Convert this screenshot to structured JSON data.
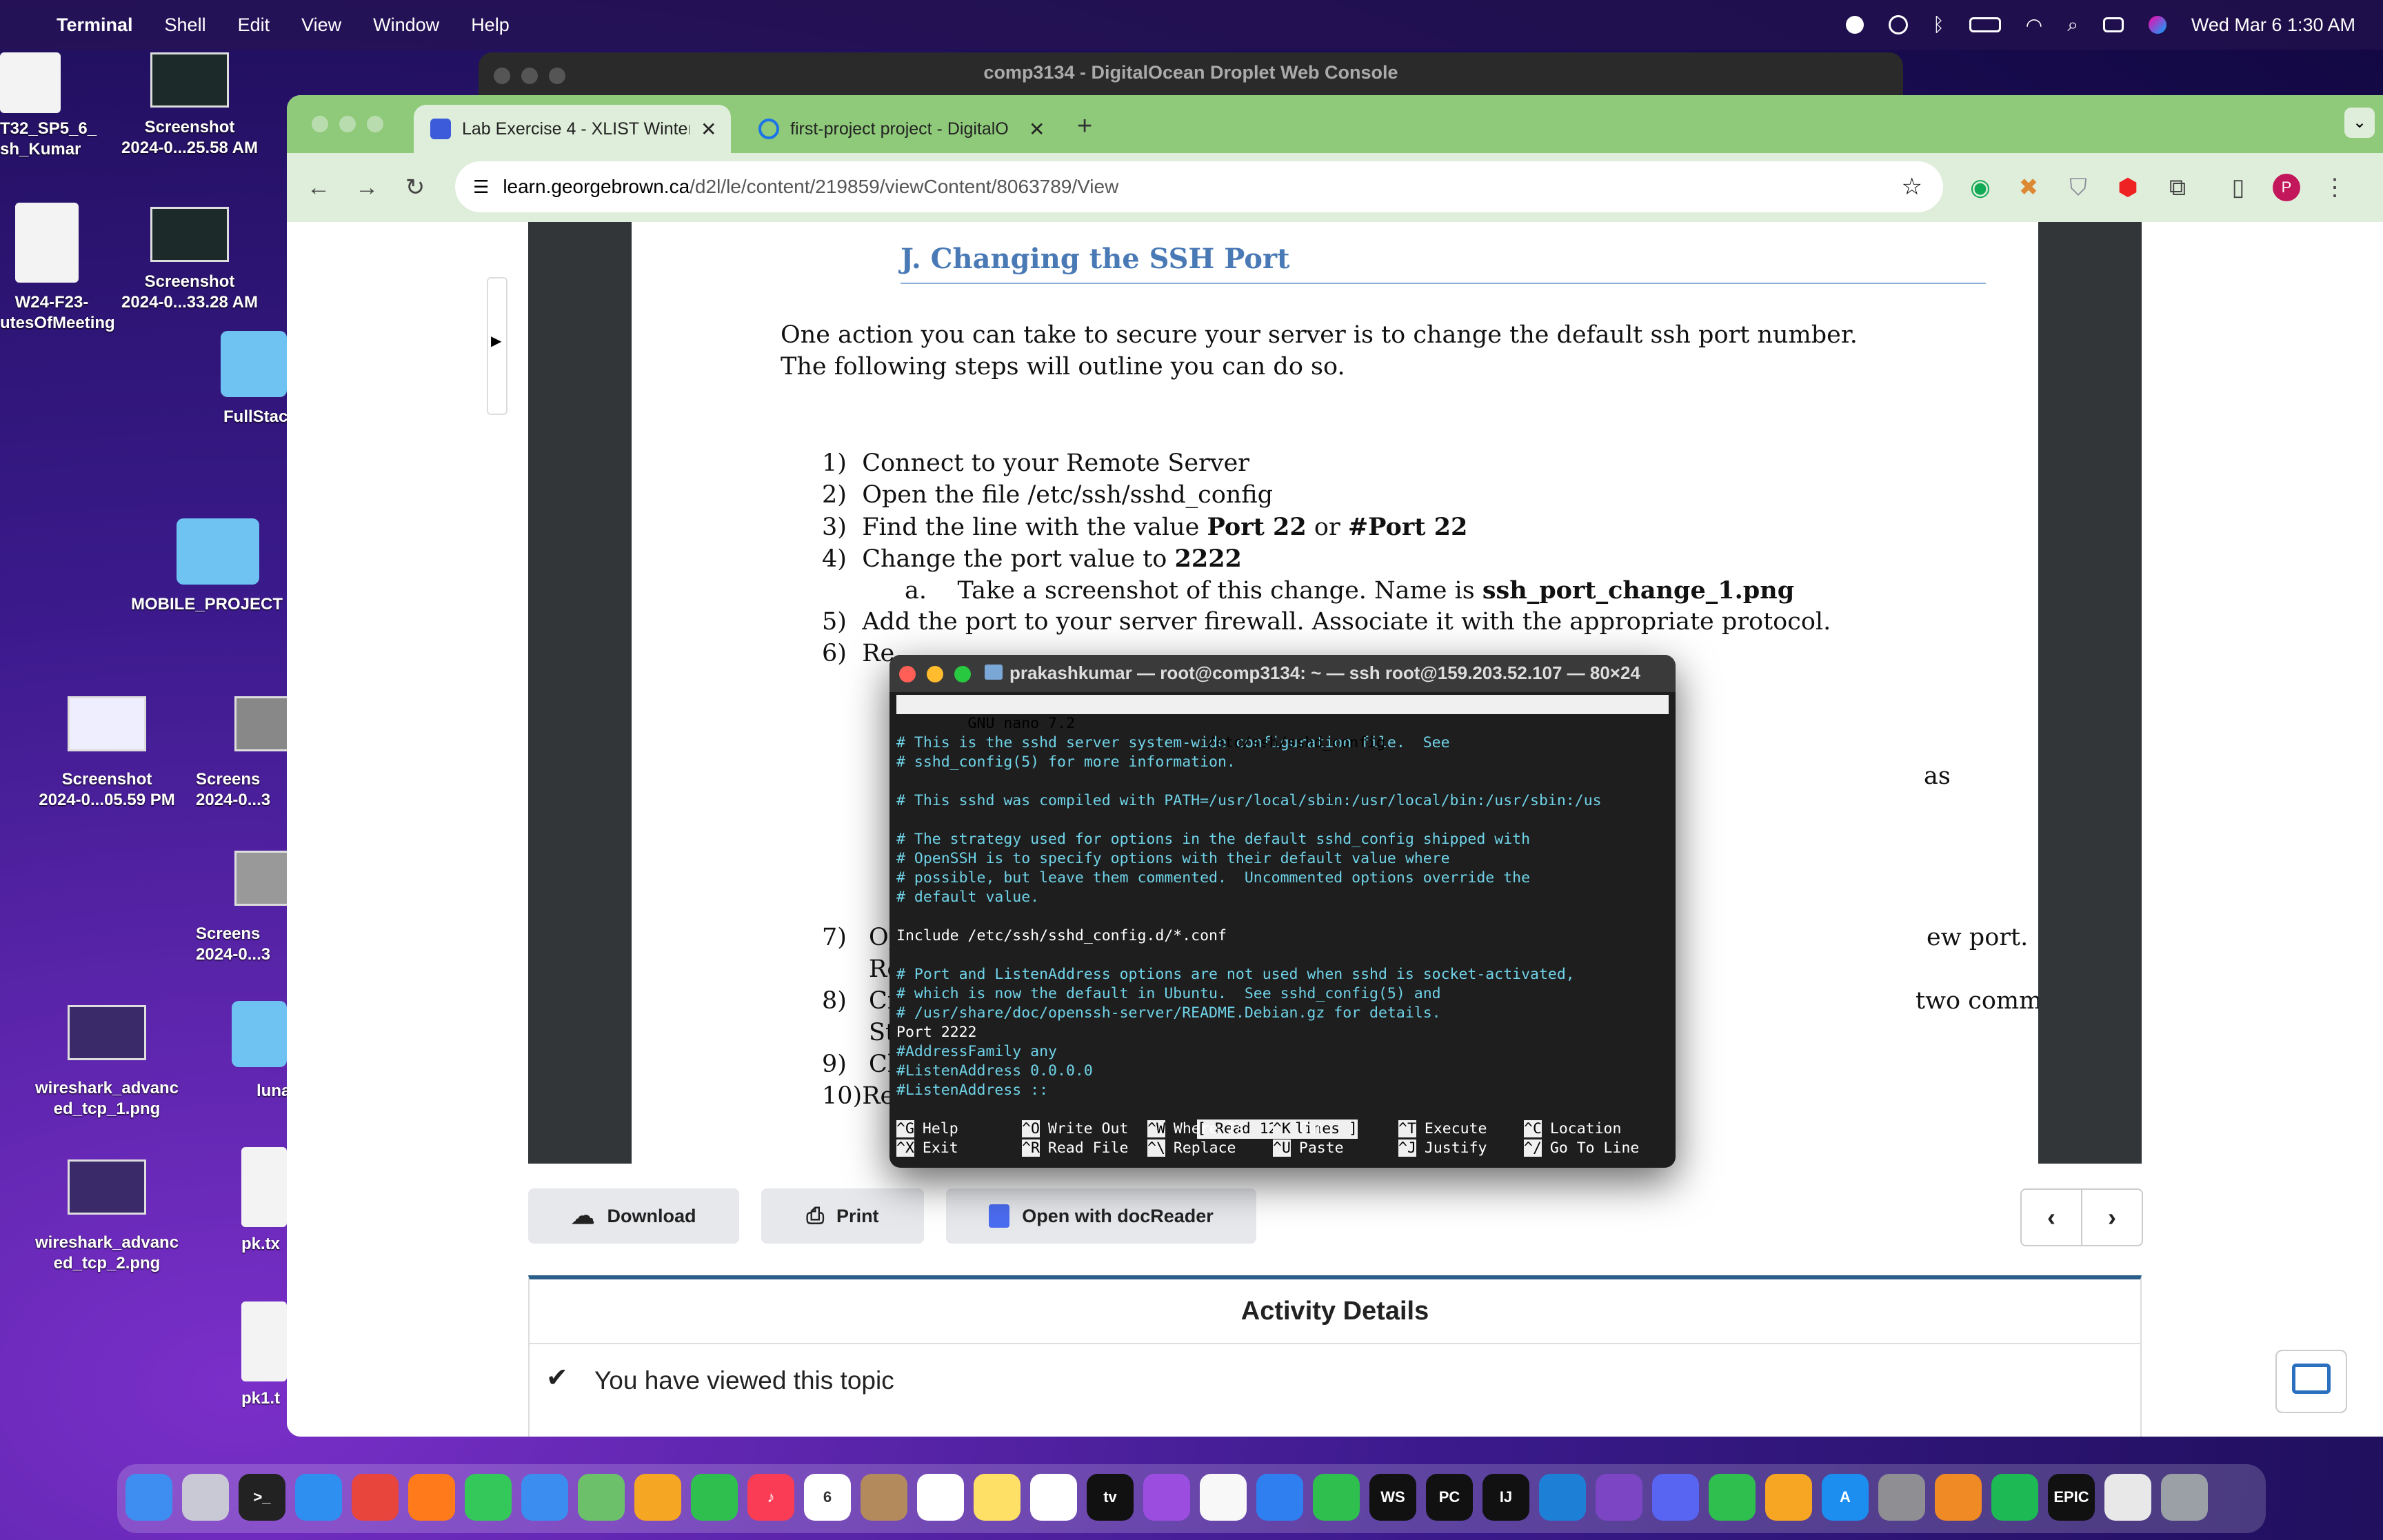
{
  "menubar": {
    "app_name": "Terminal",
    "menus": [
      "Shell",
      "Edit",
      "View",
      "Window",
      "Help"
    ],
    "datetime": "Wed Mar 6  1:30 AM"
  },
  "desktop": {
    "items": [
      {
        "label": "T32_SP5_6_\nsh_Kumar",
        "kind": "file",
        "badge": "DOCX"
      },
      {
        "label": "Screenshot\n2024-0...25.58 AM",
        "kind": "screenshot"
      },
      {
        "label": "W24-F23-\nutesOfMeeting",
        "kind": "file",
        "badge": "DOCX"
      },
      {
        "label": "Screenshot\n2024-0...33.28 AM",
        "kind": "screenshot"
      },
      {
        "label": "FullStac",
        "kind": "folder"
      },
      {
        "label": "MOBILE_PROJECT",
        "kind": "folder"
      },
      {
        "label": "Screenshot\n2024-0...05.59 PM",
        "kind": "screenshot"
      },
      {
        "label": "Screens\n2024-0...3",
        "kind": "screenshot"
      },
      {
        "label": "Screens\n2024-0...3",
        "kind": "screenshot"
      },
      {
        "label": "wireshark_advanc\ned_tcp_1.png",
        "kind": "screenshot"
      },
      {
        "label": "luna",
        "kind": "folder"
      },
      {
        "label": "wireshark_advanc\ned_tcp_2.png",
        "kind": "screenshot"
      },
      {
        "label": "pk.tx",
        "kind": "file",
        "badge": "TXT"
      },
      {
        "label": "pk1.t",
        "kind": "file",
        "badge": "TXT"
      }
    ]
  },
  "console_window": {
    "title": "comp3134 - DigitalOcean Droplet Web Console"
  },
  "browser": {
    "tabs": [
      {
        "label": "Lab Exercise 4 - XLIST Winter",
        "active": true
      },
      {
        "label": "first-project project - DigitalO",
        "active": false
      }
    ],
    "url_domain": "learn.georgebrown.ca",
    "url_path": "/d2l/le/content/219859/viewContent/8063789/View",
    "profile_initial": "P"
  },
  "document": {
    "heading": "J.  Changing the SSH Port",
    "intro_1": "One action you can take to secure your server is to change the default ssh port number.",
    "intro_2": "The following steps will outline you can do so.",
    "steps": [
      {
        "num": "1)",
        "pre": "Connect to your Remote Server",
        "bold": "",
        "post": ""
      },
      {
        "num": "2)",
        "pre": "Open the file /etc/ssh/sshd_config",
        "bold": "",
        "post": ""
      },
      {
        "num": "3)",
        "pre": "Find the line with the value ",
        "bold": "Port 22",
        "mid": " or ",
        "bold2": "#Port 22"
      },
      {
        "num": "4)",
        "pre": "Change the port value to ",
        "bold": "2222",
        "post": ""
      },
      {
        "num": "a.",
        "pre": "Take a screenshot of this change. Name is ",
        "bold": "ssh_port_change_1.png",
        "post": ""
      },
      {
        "num": "5)",
        "pre": "Add the port to your server firewall. Associate it with the appropriate protocol.",
        "bold": "",
        "post": ""
      },
      {
        "num": "6)",
        "pre": "Re",
        "bold": "",
        "post": ""
      }
    ],
    "partial_right": {
      "as": "as",
      "new_port": "ew port.",
      "two_cmds": "two commands for"
    },
    "partial_left": {
      "s7": "7)",
      "s7t": "Op",
      "s7b": "Re",
      "s8": "8)",
      "s8t": "Cr",
      "s8b": "St",
      "s9": "9)",
      "s9t": "Ch",
      "s10": "10)Re"
    }
  },
  "doc_buttons": {
    "download": "Download",
    "print": "Print",
    "open_with": "Open with docReader"
  },
  "activity": {
    "title": "Activity Details",
    "viewed": "You have viewed this topic"
  },
  "terminal": {
    "title": "prakashkumar — root@comp3134: ~ — ssh root@159.203.52.107 — 80×24",
    "nano_version": "  GNU nano 7.2",
    "nano_file": "/etc/ssh/sshd_config",
    "lines": [
      {
        "t": "",
        "c": false
      },
      {
        "t": "# This is the sshd server system-wide configuration file.  See",
        "c": true
      },
      {
        "t": "# sshd_config(5) for more information.",
        "c": true
      },
      {
        "t": "",
        "c": false
      },
      {
        "t": "# This sshd was compiled with PATH=/usr/local/sbin:/usr/local/bin:/usr/sbin:/us",
        "c": true
      },
      {
        "t": "",
        "c": false
      },
      {
        "t": "# The strategy used for options in the default sshd_config shipped with",
        "c": true
      },
      {
        "t": "# OpenSSH is to specify options with their default value where",
        "c": true
      },
      {
        "t": "# possible, but leave them commented.  Uncommented options override the",
        "c": true
      },
      {
        "t": "# default value.",
        "c": true
      },
      {
        "t": "",
        "c": false
      },
      {
        "t": "Include /etc/ssh/sshd_config.d/*.conf",
        "c": false
      },
      {
        "t": "",
        "c": false
      },
      {
        "t": "# Port and ListenAddress options are not used when sshd is socket-activated,",
        "c": true
      },
      {
        "t": "# which is now the default in Ubuntu.  See sshd_config(5) and",
        "c": true
      },
      {
        "t": "# /usr/share/doc/openssh-server/README.Debian.gz for details.",
        "c": true
      },
      {
        "t": "Port 2222",
        "c": false
      },
      {
        "t": "#AddressFamily any",
        "c": true
      },
      {
        "t": "#ListenAddress 0.0.0.0",
        "c": true
      },
      {
        "t": "#ListenAddress ::",
        "c": true
      }
    ],
    "status": "[ Read 125 lines ]",
    "shortcuts": [
      {
        "k1": "^G",
        "l1": "Help",
        "k2": "^X",
        "l2": "Exit"
      },
      {
        "k1": "^O",
        "l1": "Write Out",
        "k2": "^R",
        "l2": "Read File"
      },
      {
        "k1": "^W",
        "l1": "Where Is",
        "k2": "^\\",
        "l2": "Replace"
      },
      {
        "k1": "^K",
        "l1": "Cut",
        "k2": "^U",
        "l2": "Paste"
      },
      {
        "k1": "^T",
        "l1": "Execute",
        "k2": "^J",
        "l2": "Justify"
      },
      {
        "k1": "^C",
        "l1": "Location",
        "k2": "^/",
        "l2": "Go To Line"
      }
    ]
  },
  "dock": {
    "apps": [
      {
        "name": "finder-icon",
        "color": "#3d8ef0",
        "glyph": ""
      },
      {
        "name": "launchpad-icon",
        "color": "#c9c9d6",
        "glyph": ""
      },
      {
        "name": "terminal-app-icon",
        "color": "#222222",
        "glyph": ">_"
      },
      {
        "name": "safari-icon",
        "color": "#2f8ff0",
        "glyph": ""
      },
      {
        "name": "chrome-icon",
        "color": "#e8453c",
        "glyph": ""
      },
      {
        "name": "firefox-icon",
        "color": "#ff7a1a",
        "glyph": ""
      },
      {
        "name": "messages-icon",
        "color": "#34c759",
        "glyph": ""
      },
      {
        "name": "mail-icon",
        "color": "#3b8ef0",
        "glyph": ""
      },
      {
        "name": "maps-icon",
        "color": "#6cc06a",
        "glyph": ""
      },
      {
        "name": "photos-icon",
        "color": "#f5a623",
        "glyph": ""
      },
      {
        "name": "facetime-icon",
        "color": "#2fbf4f",
        "glyph": ""
      },
      {
        "name": "music-icon",
        "color": "#fa3c55",
        "glyph": "♪"
      },
      {
        "name": "calendar-icon",
        "color": "#ffffff",
        "glyph": "6"
      },
      {
        "name": "contacts-icon",
        "color": "#b28a5c",
        "glyph": ""
      },
      {
        "name": "reminders-icon",
        "color": "#ffffff",
        "glyph": ""
      },
      {
        "name": "notes-icon",
        "color": "#ffe066",
        "glyph": ""
      },
      {
        "name": "freeform-icon",
        "color": "#ffffff",
        "glyph": ""
      },
      {
        "name": "appletv-icon",
        "color": "#111111",
        "glyph": "tv"
      },
      {
        "name": "podcasts-icon",
        "color": "#9b4de0",
        "glyph": ""
      },
      {
        "name": "news-icon",
        "color": "#f8f8f8",
        "glyph": ""
      },
      {
        "name": "keynote-icon",
        "color": "#2f7ff0",
        "glyph": ""
      },
      {
        "name": "numbers-icon",
        "color": "#2fbf4f",
        "glyph": ""
      },
      {
        "name": "webstorm-icon",
        "color": "#111111",
        "glyph": "WS"
      },
      {
        "name": "pycharm-icon",
        "color": "#111111",
        "glyph": "PC"
      },
      {
        "name": "intellij-icon",
        "color": "#111111",
        "glyph": "IJ"
      },
      {
        "name": "vscode-icon",
        "color": "#1e7fd6",
        "glyph": ""
      },
      {
        "name": "visualstudio-icon",
        "color": "#7b45c4",
        "glyph": ""
      },
      {
        "name": "discord-icon",
        "color": "#5865f2",
        "glyph": ""
      },
      {
        "name": "whatsapp-icon",
        "color": "#2fbf4f",
        "glyph": ""
      },
      {
        "name": "pages-icon",
        "color": "#f6a623",
        "glyph": ""
      },
      {
        "name": "appstore-icon",
        "color": "#1c8ef0",
        "glyph": "A"
      },
      {
        "name": "system-settings-icon",
        "color": "#8e8e93",
        "glyph": ""
      },
      {
        "name": "vpn-icon",
        "color": "#f08a24",
        "glyph": ""
      },
      {
        "name": "spotify-icon",
        "color": "#1db954",
        "glyph": ""
      },
      {
        "name": "epic-games-icon",
        "color": "#111111",
        "glyph": "EPIC"
      },
      {
        "name": "documents-icon",
        "color": "#e8e8e8",
        "glyph": ""
      },
      {
        "name": "trash-icon",
        "color": "#9aa0a6",
        "glyph": ""
      }
    ]
  }
}
